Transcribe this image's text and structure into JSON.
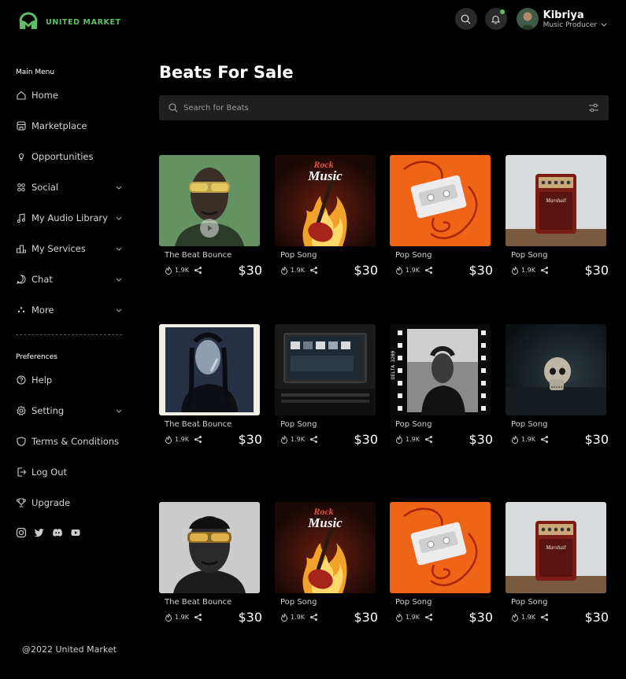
{
  "brand": {
    "name": "UNITED MARKET",
    "color": "#5fbf64"
  },
  "user": {
    "name": "Kibriya",
    "role": "Music Producer"
  },
  "sidebar": {
    "main_menu_title": "Main Menu",
    "items": [
      {
        "label": "Home",
        "icon": "home-icon",
        "has_chevron": false
      },
      {
        "label": "Marketplace",
        "icon": "store-icon",
        "has_chevron": false
      },
      {
        "label": "Opportunities",
        "icon": "lightbulb-icon",
        "has_chevron": false
      },
      {
        "label": "Social",
        "icon": "people-icon",
        "has_chevron": true
      },
      {
        "label": "My Audio Library",
        "icon": "music-note-icon",
        "has_chevron": true
      },
      {
        "label": "My Services",
        "icon": "services-icon",
        "has_chevron": true
      },
      {
        "label": "Chat",
        "icon": "chat-icon",
        "has_chevron": true
      },
      {
        "label": "More",
        "icon": "more-icon",
        "has_chevron": true
      }
    ],
    "preferences_title": "Preferences",
    "pref_items": [
      {
        "label": "Help",
        "icon": "help-icon",
        "has_chevron": false
      },
      {
        "label": "Setting",
        "icon": "gear-icon",
        "has_chevron": true
      },
      {
        "label": "Terms & Conditions",
        "icon": "shield-icon",
        "has_chevron": false
      },
      {
        "label": "Log Out",
        "icon": "logout-icon",
        "has_chevron": false
      },
      {
        "label": "Upgrade",
        "icon": "trophy-icon",
        "has_chevron": false
      }
    ],
    "socials": [
      "instagram-icon",
      "twitter-icon",
      "discord-icon",
      "youtube-icon"
    ],
    "copyright": "@2022 United Market"
  },
  "main": {
    "title": "Beats For Sale",
    "search_placeholder": "Search for Beats",
    "cards": [
      {
        "title": "The Beat Bounce",
        "likes": "1.9K",
        "price": "$30",
        "art": "portrait-green",
        "playing": true
      },
      {
        "title": "Pop Song",
        "likes": "1.9K",
        "price": "$30",
        "art": "rock-music",
        "playing": false
      },
      {
        "title": "Pop Song",
        "likes": "1.9K",
        "price": "$30",
        "art": "cassette",
        "playing": false
      },
      {
        "title": "Pop Song",
        "likes": "1.9K",
        "price": "$30",
        "art": "amp",
        "playing": false
      },
      {
        "title": "The Beat Bounce",
        "likes": "1.9K",
        "price": "$30",
        "art": "polaroid",
        "playing": false
      },
      {
        "title": "Pop Song",
        "likes": "1.9K",
        "price": "$30",
        "art": "studio",
        "playing": false
      },
      {
        "title": "Pop Song",
        "likes": "1.9K",
        "price": "$30",
        "art": "film",
        "playing": false
      },
      {
        "title": "Pop Song",
        "likes": "1.9K",
        "price": "$30",
        "art": "skull",
        "playing": false
      },
      {
        "title": "The Beat Bounce",
        "likes": "1.9K",
        "price": "$30",
        "art": "portrait-bw",
        "playing": false
      },
      {
        "title": "Pop Song",
        "likes": "1.9K",
        "price": "$30",
        "art": "rock-music",
        "playing": false
      },
      {
        "title": "Pop Song",
        "likes": "1.9K",
        "price": "$30",
        "art": "cassette",
        "playing": false
      },
      {
        "title": "Pop Song",
        "likes": "1.9K",
        "price": "$30",
        "art": "amp",
        "playing": false
      }
    ],
    "art_text": {
      "rock": "Rock",
      "music": "Music",
      "amp_brand": "Marshall",
      "film_code": "DELTA 3200"
    }
  }
}
